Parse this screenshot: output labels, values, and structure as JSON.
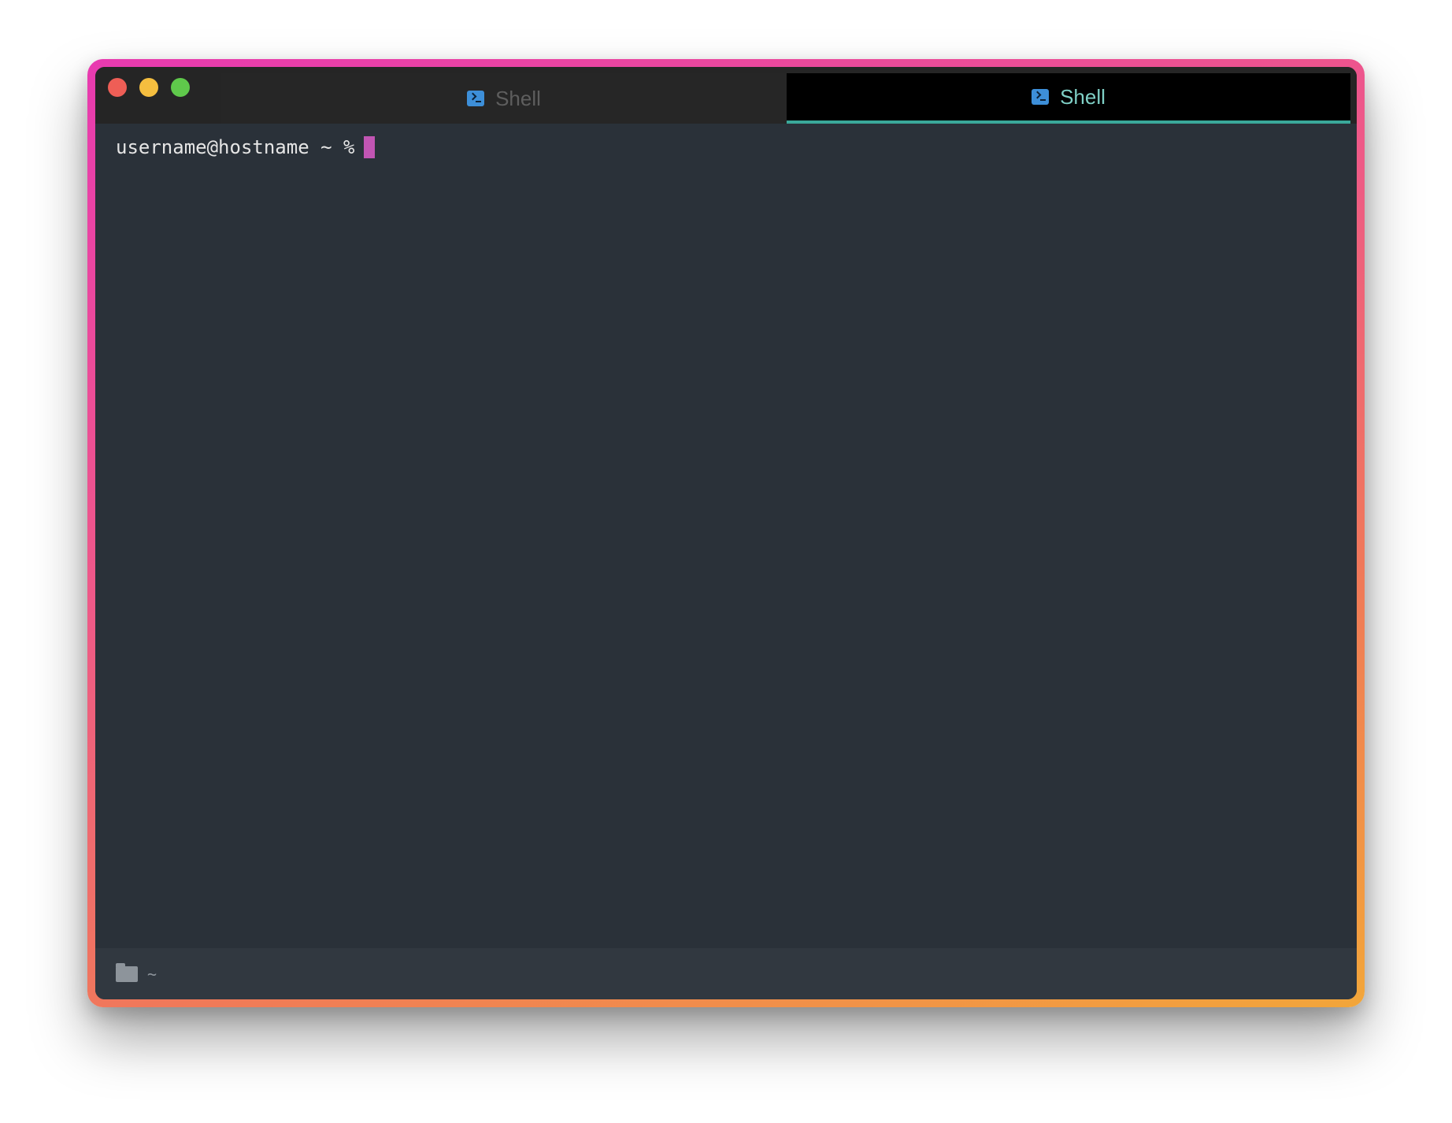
{
  "window": {
    "traffic_lights": {
      "close_color": "#ee5e56",
      "minimize_color": "#f5be3f",
      "maximize_color": "#5fc94b"
    },
    "frame_gradient": [
      "#e83ab0",
      "#ee5a86",
      "#f07a58",
      "#f2a63a"
    ]
  },
  "tabs": [
    {
      "label": "Shell",
      "icon": "terminal-icon",
      "active": false
    },
    {
      "label": "Shell",
      "icon": "terminal-icon",
      "active": true
    }
  ],
  "terminal": {
    "prompt": "username@hostname ~ %",
    "cursor_color": "#c155b3",
    "background": "#2a3139",
    "text_color": "#e6e6e6"
  },
  "statusbar": {
    "icon": "folder-icon",
    "path": "~"
  },
  "colors": {
    "active_tab_underline": "#3aa89a",
    "active_tab_text": "#7fd0c6",
    "inactive_tab_text": "#5e5e5e",
    "tab_icon": "#3d8fd9"
  }
}
